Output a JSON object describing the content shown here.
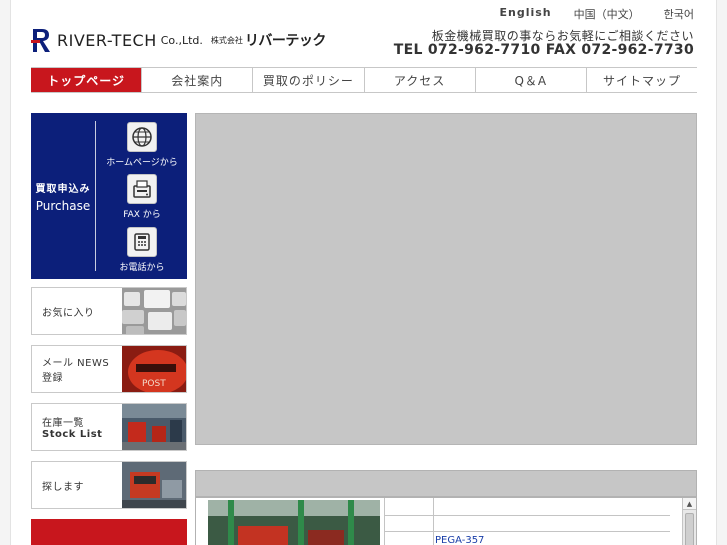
{
  "header": {
    "logo_name": "RIVER-TECH",
    "logo_co": "Co.,Ltd.",
    "logo_jp_small": "株式会社",
    "logo_jp": "リバーテック",
    "tagline": "板金機械買取の事ならお気軽にご相談ください",
    "contact": "TEL 072-962-7710  FAX 072-962-7730"
  },
  "lang": {
    "en": "English",
    "cn": "中国（中文）",
    "kr": "한국어"
  },
  "nav": {
    "items": [
      {
        "label": "トップページ",
        "active": true
      },
      {
        "label": "会社案内"
      },
      {
        "label": "買取のポリシー"
      },
      {
        "label": "アクセス"
      },
      {
        "label": "Q＆A"
      },
      {
        "label": "サイトマップ"
      }
    ]
  },
  "purchase": {
    "title_jp": "買取申込み",
    "title_en": "Purchase",
    "options": [
      {
        "label": "ホームページから",
        "icon": "globe-icon"
      },
      {
        "label": "FAX から",
        "icon": "fax-icon"
      },
      {
        "label": "お電話から",
        "icon": "phone-icon"
      }
    ]
  },
  "sidebar": {
    "favorites": "お気に入り",
    "mail_line1": "メール NEWS",
    "mail_line2": "登録",
    "stock_line1": "在庫一覧",
    "stock_line2": "Stock List",
    "search": "探します"
  },
  "panel": {
    "model": "PEGA-357"
  },
  "colors": {
    "accent_red": "#c8161d",
    "navy": "#0c1f7a",
    "link_blue": "#1a3ea8"
  }
}
